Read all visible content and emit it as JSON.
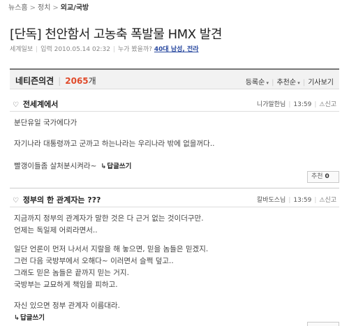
{
  "breadcrumb": {
    "home": "뉴스홈",
    "section": "정치",
    "current": "외교/국방"
  },
  "article": {
    "title": "[단독] 천안함서 고농축 폭발물 HMX 발견",
    "source": "세계일보",
    "published": "입력 2010.05.14 02:32",
    "readers_label": "누가 봤을까?",
    "readers_value": "40대 남성, 전라"
  },
  "comments_header": {
    "title": "네티즌의견",
    "count": "2065",
    "count_unit": "개",
    "sort_options": [
      "등록순",
      "추천순"
    ],
    "write_label": "기사보기"
  },
  "comments": [
    {
      "title": "전세계에서",
      "author": "니가말한님",
      "time": "13:59",
      "report": "신고",
      "lines": [
        "분단유일 국가에다가",
        "자기나라 대통령까고 군까고 하는나라는 우리나라 밖에 없을꺼다..",
        "빨갱이들좀 살처분시켜라~"
      ],
      "reply_label": "답글쓰기",
      "recommend_label": "추천",
      "recommend_count": "0"
    },
    {
      "title": "정부의 한 관계자는 ???",
      "author": "칼바도스님",
      "time": "13:59",
      "report": "신고",
      "lines": [
        "지금까지 정부의 관계자가 말한 것은 다 근거 없는 것이더구만.",
        "언제는 독일제 어뢰라면서..",
        "일단 언론이 먼저 나서서 지랄을 해 놓으면, 믿을 놈들은 믿겠지.",
        "그런 다음 국방부에서 오해다~ 이러면서 슬쩍 덮고..",
        "그래도 믿은 놈들은 끝까지 믿는 거지.",
        "국방부는 교묘하게 책임을 피하고.",
        "자신 있으면 정부 관계자 이름대라."
      ],
      "reply_label": "답글쓰기"
    }
  ]
}
